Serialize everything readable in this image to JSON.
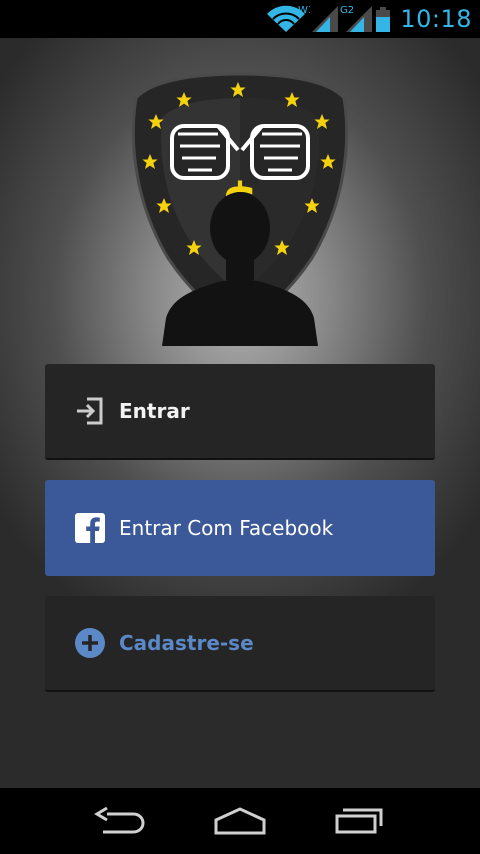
{
  "status_bar": {
    "time": "10:18",
    "wifi_badge": "W1",
    "network_badge": "G2",
    "icons": [
      "wifi-icon",
      "signal-icon",
      "battery-icon"
    ]
  },
  "buttons": {
    "login_label": "Entrar",
    "facebook_label": "Entrar Com Facebook",
    "signup_label": "Cadastre-se"
  },
  "logo": {
    "symbol": "$"
  },
  "nav": {
    "icons": [
      "back-icon",
      "home-icon",
      "recent-apps-icon"
    ]
  },
  "colors": {
    "accent_time": "#33b5e5",
    "facebook_blue": "#3b5898",
    "signup_text": "#5b88c6",
    "dark_button": "#252525",
    "star_yellow": "#f5d20e"
  }
}
